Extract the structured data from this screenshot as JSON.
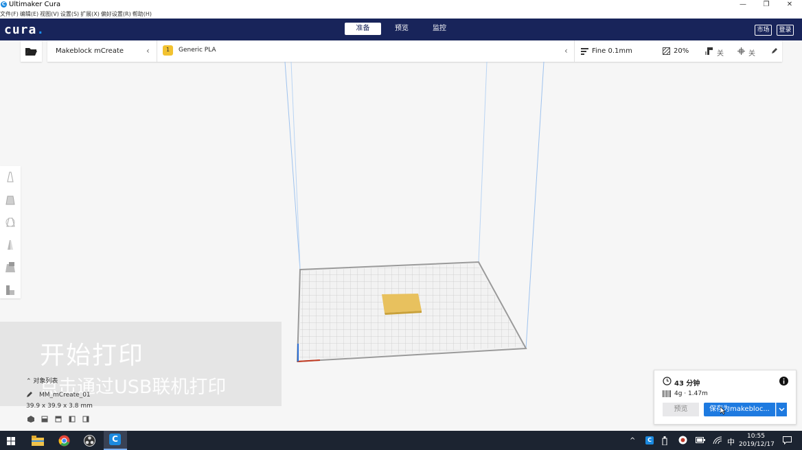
{
  "window": {
    "title": "Ultimaker Cura",
    "controls": {
      "minimize": "—",
      "restore": "❐",
      "close": "✕"
    }
  },
  "menu": [
    "文件(F)",
    "编辑(E)",
    "视图(V)",
    "设置(S)",
    "扩展(X)",
    "偏好设置(R)",
    "帮助(H)"
  ],
  "header": {
    "brand": "cura",
    "brand_dot": ".",
    "tabs": [
      {
        "label": "准备",
        "active": true
      },
      {
        "label": "预览",
        "active": false
      },
      {
        "label": "监控",
        "active": false
      }
    ],
    "marketplace": "市场",
    "signin": "登录"
  },
  "toolbar": {
    "printer": "Makeblock mCreate",
    "material": "Generic PLA",
    "material_badge": "1",
    "profile": "Fine 0.1mm",
    "infill": "20%",
    "support": "关",
    "adhesion": "关"
  },
  "overlay": {
    "title": "开始打印",
    "subtitle": "点击通过USB联机打印"
  },
  "object_list": {
    "header": "对象列表",
    "object_name": "MM_mCreate_01",
    "dimensions": "39.9 x 39.9 x 3.8 mm"
  },
  "print_panel": {
    "time": "43 分钟",
    "material_usage": "4g · 1.47m",
    "preview_label": "预览",
    "save_label": "保存为makebloc..."
  },
  "taskbar": {
    "ime": "中",
    "time": "10:55",
    "date": "2019/12/17"
  },
  "colors": {
    "header": "#18245a",
    "accent": "#1e7ae0",
    "model": "#e8c15e",
    "taskbar": "#1c2431"
  }
}
